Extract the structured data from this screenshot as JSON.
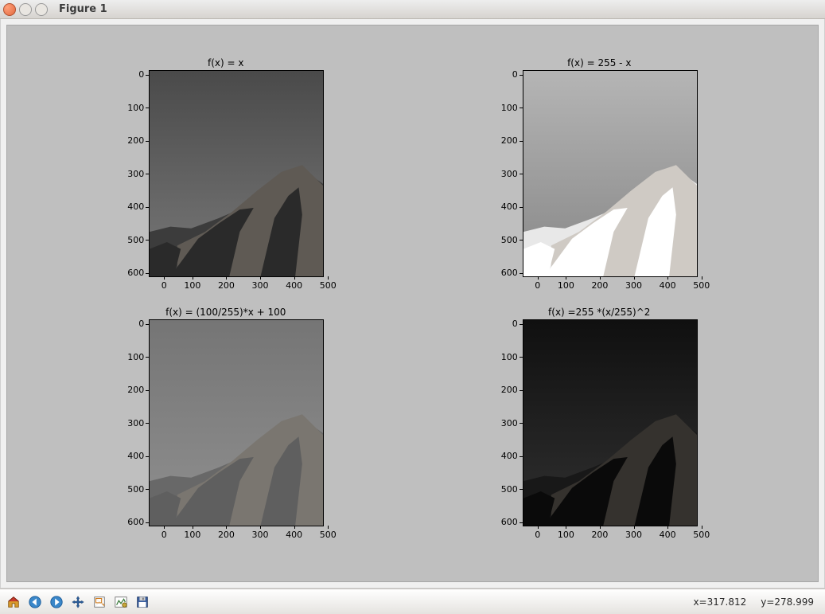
{
  "window": {
    "title": "Figure 1"
  },
  "plots": [
    {
      "title": "f(x) = x",
      "variant": "img-identity"
    },
    {
      "title": "f(x) = 255 - x",
      "variant": "img-invert"
    },
    {
      "title": "f(x) = (100/255)*x + 100",
      "variant": "img-compress"
    },
    {
      "title": "f(x) =255 *(x/255)^2",
      "variant": "img-square"
    }
  ],
  "axes": {
    "xticks": [
      "0",
      "100",
      "200",
      "300",
      "400",
      "500"
    ],
    "yticks": [
      "0",
      "100",
      "200",
      "300",
      "400",
      "500",
      "600"
    ]
  },
  "toolbar": {
    "buttons": [
      {
        "name": "home-button",
        "icon": "home-icon"
      },
      {
        "name": "back-button",
        "icon": "back-icon"
      },
      {
        "name": "forward-button",
        "icon": "forward-icon"
      },
      {
        "name": "pan-button",
        "icon": "pan-icon"
      },
      {
        "name": "zoom-button",
        "icon": "zoom-icon"
      },
      {
        "name": "configure-button",
        "icon": "configure-icon"
      },
      {
        "name": "save-button",
        "icon": "save-icon"
      }
    ]
  },
  "status": {
    "x_label": "x=317.812",
    "y_label": "y=278.999"
  }
}
